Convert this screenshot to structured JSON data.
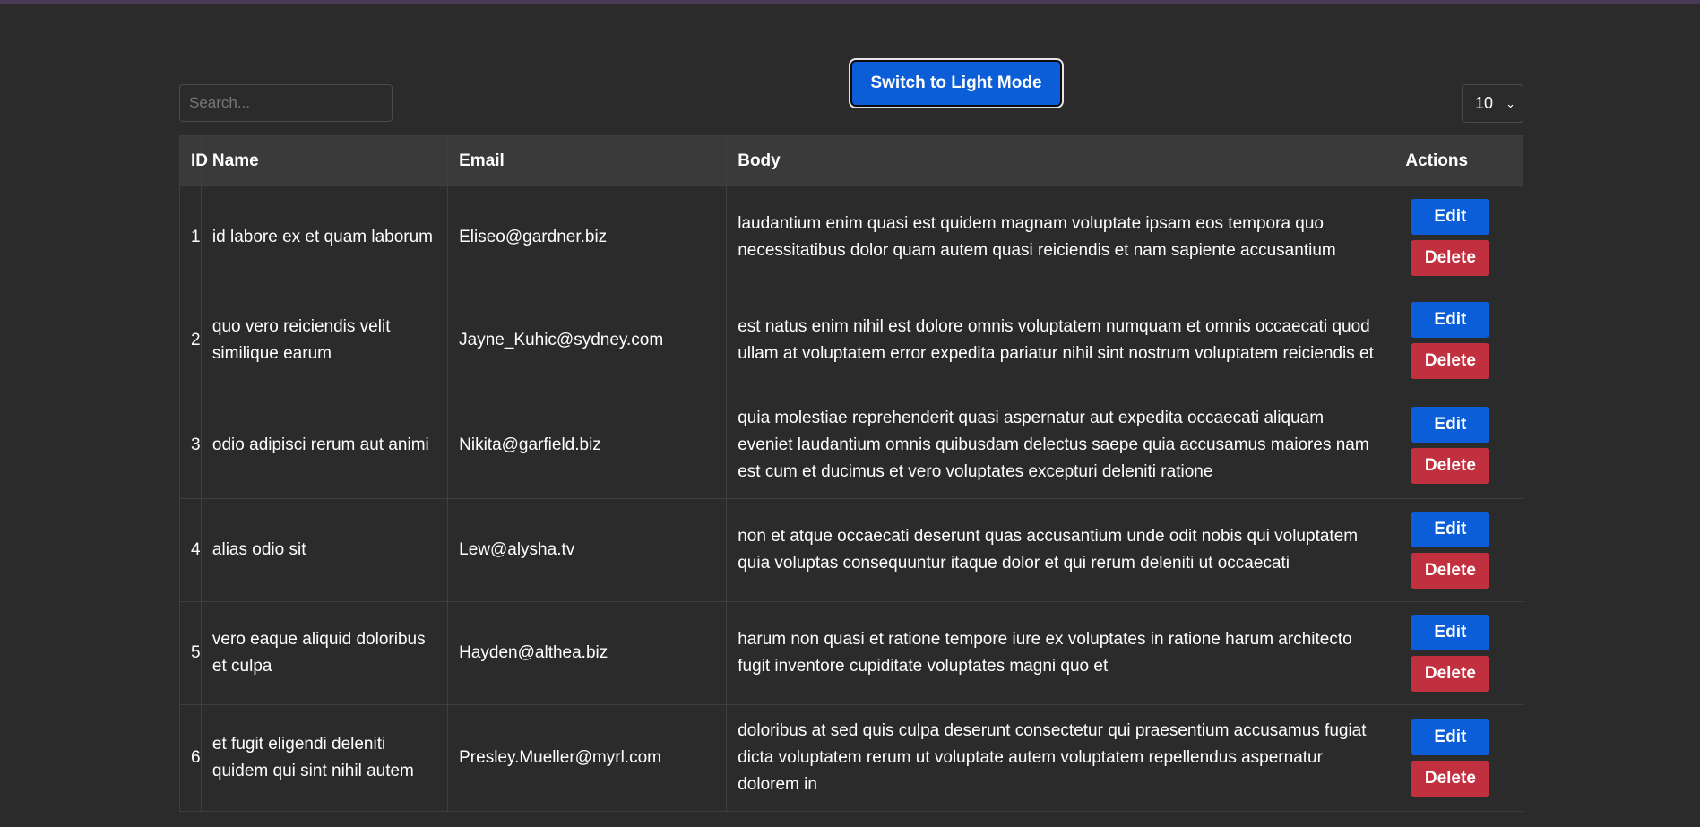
{
  "toolbar": {
    "search_placeholder": "Search...",
    "theme_button_label": "Switch to Light Mode",
    "page_size_value": "10"
  },
  "table": {
    "headers": {
      "id": "ID",
      "name": "Name",
      "email": "Email",
      "body": "Body",
      "actions": "Actions"
    },
    "edit_label": "Edit",
    "delete_label": "Delete",
    "rows": [
      {
        "id": "1",
        "name": "id labore ex et quam laborum",
        "email": "Eliseo@gardner.biz",
        "body": "laudantium enim quasi est quidem magnam voluptate ipsam eos tempora quo necessitatibus dolor quam autem quasi reiciendis et nam sapiente accusantium"
      },
      {
        "id": "2",
        "name": "quo vero reiciendis velit similique earum",
        "email": "Jayne_Kuhic@sydney.com",
        "body": "est natus enim nihil est dolore omnis voluptatem numquam et omnis occaecati quod ullam at voluptatem error expedita pariatur nihil sint nostrum voluptatem reiciendis et"
      },
      {
        "id": "3",
        "name": "odio adipisci rerum aut animi",
        "email": "Nikita@garfield.biz",
        "body": "quia molestiae reprehenderit quasi aspernatur aut expedita occaecati aliquam eveniet laudantium omnis quibusdam delectus saepe quia accusamus maiores nam est cum et ducimus et vero voluptates excepturi deleniti ratione"
      },
      {
        "id": "4",
        "name": "alias odio sit",
        "email": "Lew@alysha.tv",
        "body": "non et atque occaecati deserunt quas accusantium unde odit nobis qui voluptatem quia voluptas consequuntur itaque dolor et qui rerum deleniti ut occaecati"
      },
      {
        "id": "5",
        "name": "vero eaque aliquid doloribus et culpa",
        "email": "Hayden@althea.biz",
        "body": "harum non quasi et ratione tempore iure ex voluptates in ratione harum architecto fugit inventore cupiditate voluptates magni quo et"
      },
      {
        "id": "6",
        "name": "et fugit eligendi deleniti quidem qui sint nihil autem",
        "email": "Presley.Mueller@myrl.com",
        "body": "doloribus at sed quis culpa deserunt consectetur qui praesentium accusamus fugiat dicta voluptatem rerum ut voluptate autem voluptatem repellendus aspernatur dolorem in"
      }
    ]
  }
}
